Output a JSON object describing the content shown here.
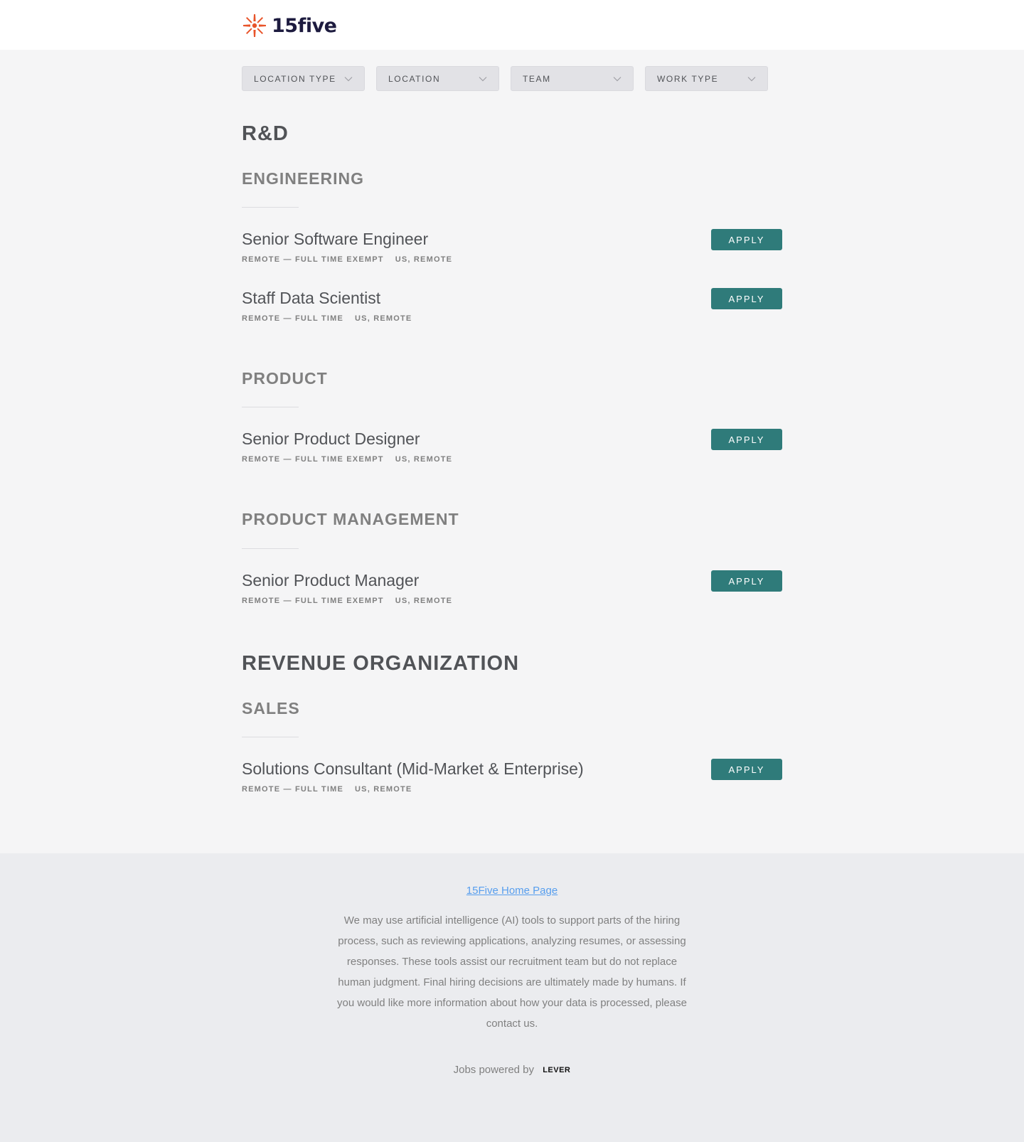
{
  "brand": {
    "logo_text": "15five",
    "accent": "#e8542a",
    "logo_dark": "#1d1b3f"
  },
  "filters": [
    {
      "label": "LOCATION TYPE"
    },
    {
      "label": "LOCATION"
    },
    {
      "label": "TEAM"
    },
    {
      "label": "WORK TYPE"
    }
  ],
  "colors": {
    "apply_button": "#2f7b7a",
    "page_bg": "#f5f5f6",
    "footer_bg": "#ebecef",
    "link": "#579eee"
  },
  "orgs": [
    {
      "name": "R&D",
      "teams": [
        {
          "name": "ENGINEERING",
          "postings": [
            {
              "title": "Senior Software Engineer",
              "work_type": "REMOTE — FULL TIME EXEMPT",
              "location": "US, REMOTE",
              "apply": "APPLY"
            },
            {
              "title": "Staff Data Scientist",
              "work_type": "REMOTE — FULL TIME",
              "location": "US, REMOTE",
              "apply": "APPLY"
            }
          ]
        },
        {
          "name": "PRODUCT",
          "postings": [
            {
              "title": "Senior Product Designer",
              "work_type": "REMOTE — FULL TIME EXEMPT",
              "location": "US, REMOTE",
              "apply": "APPLY"
            }
          ]
        },
        {
          "name": "PRODUCT MANAGEMENT",
          "postings": [
            {
              "title": "Senior Product Manager",
              "work_type": "REMOTE — FULL TIME EXEMPT",
              "location": "US, REMOTE",
              "apply": "APPLY"
            }
          ]
        }
      ]
    },
    {
      "name": "REVENUE ORGANIZATION",
      "teams": [
        {
          "name": "SALES",
          "postings": [
            {
              "title": "Solutions Consultant (Mid-Market & Enterprise)",
              "work_type": "REMOTE — FULL TIME",
              "location": "US, REMOTE",
              "apply": "APPLY"
            }
          ]
        }
      ]
    }
  ],
  "footer": {
    "home_link": "15Five Home Page",
    "ai_note": "We may use artificial intelligence (AI) tools to support parts of the hiring process, such as reviewing applications, analyzing resumes, or assessing responses. These tools assist our recruitment team but do not replace human judgment. Final hiring decisions are ultimately made by humans. If you would like more information about how your data is processed, please contact us.",
    "powered_by": "Jobs powered by",
    "powered_brand": "LEVER"
  }
}
